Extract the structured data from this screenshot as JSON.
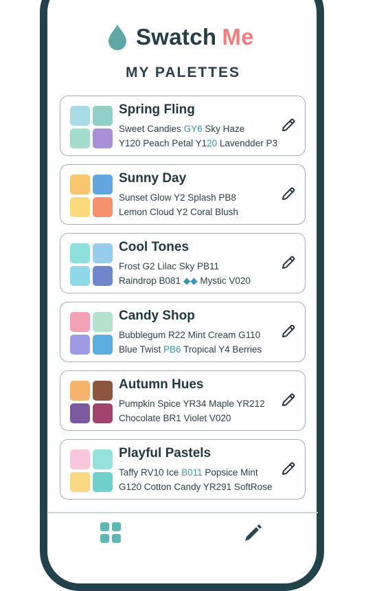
{
  "app": {
    "brand_part1": "Swatch",
    "brand_part2": "Me",
    "page_title": "MY PALETTES"
  },
  "colors": {
    "brand_dark": "#243d46",
    "brand_accent": "#ef7f7f",
    "drop": "#5fa8a7",
    "code_highlight": "#3d94ac",
    "nav_accent": "#5eb7b2"
  },
  "palettes": [
    {
      "name": "Spring Fling",
      "line1": [
        {
          "t": "Sweet Candies "
        },
        {
          "t": "GY6",
          "hl": true
        },
        {
          "t": "  Sky Haze"
        }
      ],
      "line2": [
        {
          "t": "Y120  Peach Petal  Y1"
        },
        {
          "t": "20",
          "hl": true
        },
        {
          "t": "  Lavendder P3"
        }
      ],
      "swatches": [
        "#a9dde6",
        "#8fd0c8",
        "#a2dccd",
        "#a98fd6"
      ],
      "icon": "edit-pencil-icon"
    },
    {
      "name": "Sunny Day",
      "line1": [
        {
          "t": "Sunset Glow Y2  Splash  PB8"
        }
      ],
      "line2": [
        {
          "t": "Lemon Cloud  Y2  Coral Blush"
        }
      ],
      "swatches": [
        "#f9c46e",
        "#62a8de",
        "#fbd97c",
        "#f6916e"
      ],
      "icon": "edit-pencil-icon"
    },
    {
      "name": "Cool Tones",
      "line1": [
        {
          "t": "Frost  G2  Lilac Sky  PB11"
        }
      ],
      "line2": [
        {
          "t": "Raindrop  B081  "
        },
        {
          "t": "◆◆",
          "hl": true
        },
        {
          "t": " Mystic  V020"
        }
      ],
      "swatches": [
        "#8fe0da",
        "#96cdea",
        "#90d9ea",
        "#6d86cc"
      ],
      "icon": "edit-pencil-icon"
    },
    {
      "name": "Candy Shop",
      "line1": [
        {
          "t": "Bubblegum  R22  Mint Cream  G110"
        }
      ],
      "line2": [
        {
          "t": "Blue Twist  "
        },
        {
          "t": "PB6",
          "hl": true
        },
        {
          "t": "  Tropical  Y4  Berries"
        }
      ],
      "swatches": [
        "#f3a1b5",
        "#b4e2cd",
        "#9e9ae3",
        "#5baee0"
      ],
      "icon": "edit-pencil-icon"
    },
    {
      "name": "Autumn Hues",
      "line1": [
        {
          "t": "Pumpkin Spice  YR34  Maple  YR212"
        }
      ],
      "line2": [
        {
          "t": "Chocolate  BR1  Violet  V020"
        }
      ],
      "swatches": [
        "#f6b36e",
        "#8c553e",
        "#7c5aa0",
        "#a2436b"
      ],
      "icon": "edit-pencil-icon"
    },
    {
      "name": "Playful Pastels",
      "line1": [
        {
          "t": "Taffy  RV10  Ice  "
        },
        {
          "t": "B011",
          "hl": true
        },
        {
          "t": "  Popsice Mint"
        }
      ],
      "line2": [
        {
          "t": "G120  Cotton Candy  YR291  SoftRose"
        }
      ],
      "swatches": [
        "#f8c7dd",
        "#93e2de",
        "#fbd984",
        "#6fd0cc"
      ],
      "icon": "edit-pencil-icon"
    }
  ],
  "nav": {
    "left_icon": "palettes-grid-icon",
    "right_icon": "edit-pencil-icon"
  }
}
